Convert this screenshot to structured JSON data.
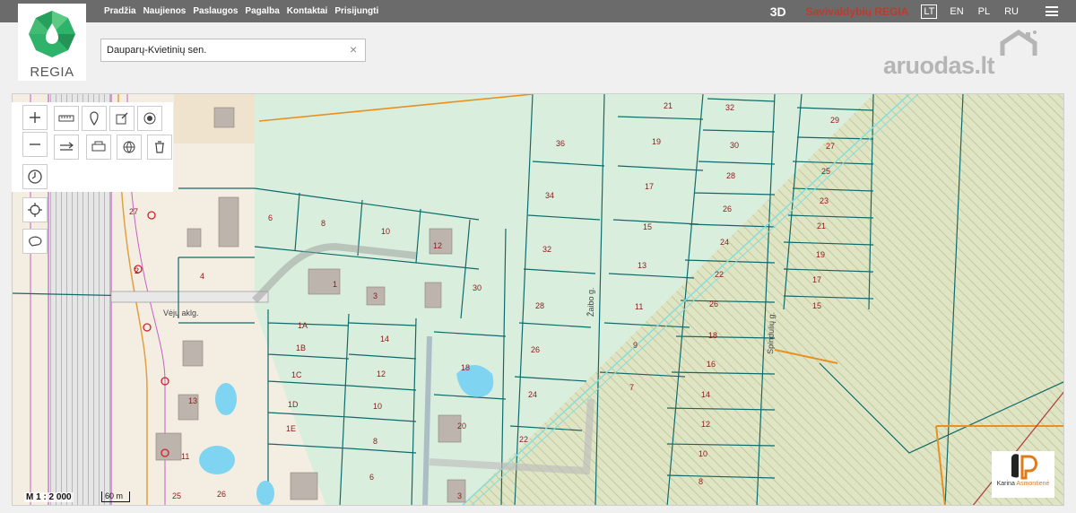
{
  "nav": {
    "items": [
      "Pradžia",
      "Naujienos",
      "Paslaugos",
      "Pagalba",
      "Kontaktai",
      "Prisijungti"
    ]
  },
  "header": {
    "btn_3d": "3D",
    "brand": "Savivaldybių REGIA",
    "languages": [
      "LT",
      "EN",
      "PL",
      "RU"
    ],
    "active_language": "LT"
  },
  "logo": {
    "label": "REGIA"
  },
  "search": {
    "value": "Dauparų-Kvietinių sen.",
    "clear": "×"
  },
  "aruodas": {
    "text": "aruodas",
    "suffix": ".lt"
  },
  "map": {
    "scale_text": "M 1 : 2 000",
    "scale_bar_label": "60 m",
    "streets": [
      "Vėjų aklg.",
      "Žaibo g.",
      "Spindulių g."
    ],
    "parcels": [
      "21",
      "32",
      "29",
      "36",
      "19",
      "30",
      "27",
      "28",
      "25",
      "34",
      "17",
      "26",
      "23",
      "6",
      "8",
      "10",
      "12",
      "21",
      "15",
      "24",
      "32",
      "4",
      "19",
      "13",
      "22",
      "17",
      "1",
      "3",
      "30",
      "28",
      "11",
      "26",
      "15",
      "1A",
      "14",
      "18",
      "9",
      "18",
      "1B",
      "16",
      "1C",
      "12",
      "26",
      "7",
      "14",
      "1D",
      "10",
      "24",
      "1E",
      "20",
      "12",
      "11",
      "8",
      "22",
      "10",
      "6",
      "8",
      "2",
      "13",
      "27",
      "25",
      "26",
      "3"
    ],
    "colors": {
      "parcel": "#0f6b6b",
      "forest": "#cfe0bf",
      "meadow": "#d9eedd",
      "road": "#c75fc7",
      "water": "#7fd4f2"
    }
  },
  "agent": {
    "first": "Karina",
    "last": "Asmontienė"
  },
  "colors": {
    "topbar": "#6b6b6b",
    "brand_red": "#c0392b",
    "logo_green": "#2fb36b"
  }
}
